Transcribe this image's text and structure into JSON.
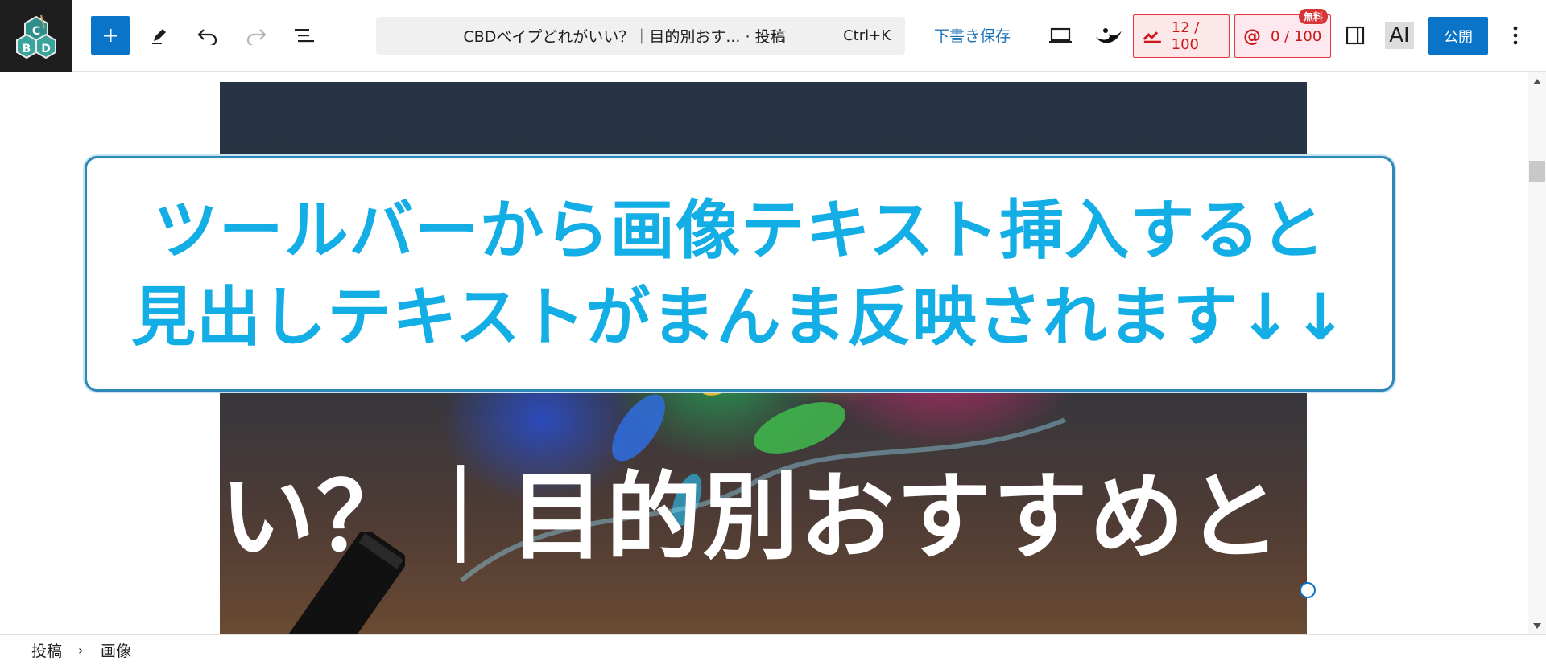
{
  "toolbar": {
    "logo_text": "CBD",
    "command_title": "CBDベイプどれがいい？｜目的別おす... · 投稿",
    "command_shortcut": "Ctrl+K",
    "save_draft_label": "下書き保存",
    "score_a": "12 / 100",
    "score_b": "0 / 100",
    "free_tag": "無料",
    "ai_label": "AI",
    "publish_label": "公開",
    "accent_color": "#0a74c9",
    "icons": [
      "plus-icon",
      "pen-icon",
      "undo-icon",
      "redo-icon",
      "list-view-icon",
      "desktop-preview-icon",
      "brand-swirl-icon",
      "seo-score-icon",
      "at-score-icon",
      "sidebar-toggle-icon",
      "more-options-icon"
    ]
  },
  "canvas": {
    "hero_text": "い？｜目的別おすすめと",
    "callout_line1": "ツールバーから画像テキスト挿入すると",
    "callout_line2": "見出しテキストがまんま反映されます↓↓",
    "callout_color": "#13aee6"
  },
  "breadcrumb": {
    "item1": "投稿",
    "separator": "›",
    "item2": "画像"
  }
}
